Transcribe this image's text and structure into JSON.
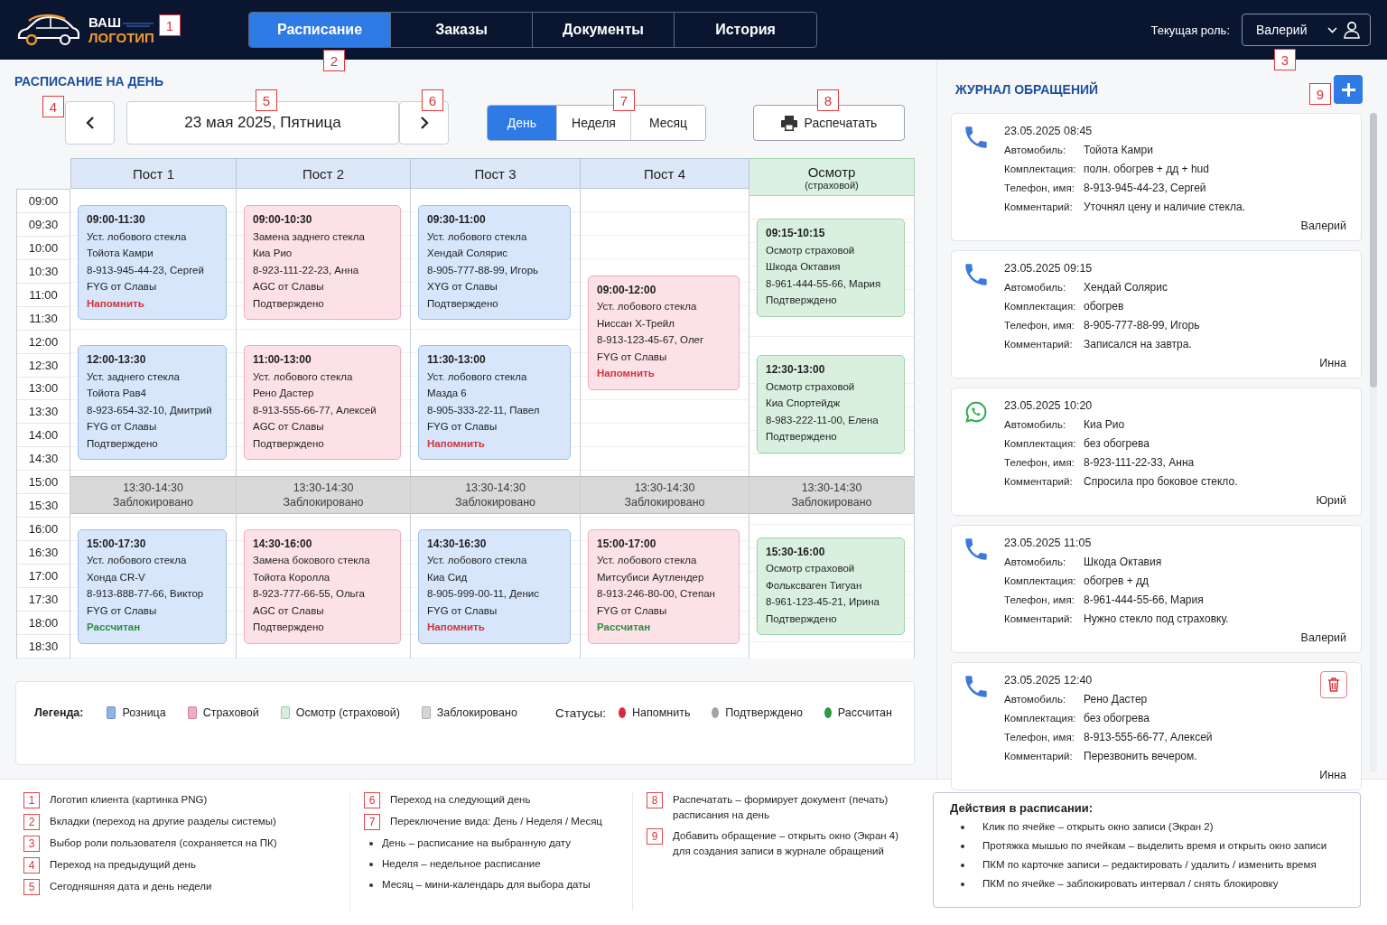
{
  "header": {
    "logo": {
      "line_1": "ВАШ",
      "line_2": "ЛОГОТИП"
    },
    "tabs": [
      {
        "label": "Расписание",
        "selected": true
      },
      {
        "label": "Заказы",
        "selected": false
      },
      {
        "label": "Документы",
        "selected": false
      },
      {
        "label": "История",
        "selected": false
      }
    ],
    "role": {
      "label": "Текущая роль:",
      "value": "Валерий"
    }
  },
  "schedule": {
    "title": "РАСПИСАНИЕ НА ДЕНЬ",
    "date": "23 мая 2025, Пятница",
    "views": [
      {
        "label": "День",
        "selected": true
      },
      {
        "label": "Неделя",
        "selected": false
      },
      {
        "label": "Месяц",
        "selected": false
      }
    ],
    "print_button": "Распечатать",
    "times": [
      "09:00",
      "09:30",
      "10:00",
      "10:30",
      "11:00",
      "11:30",
      "12:00",
      "12:30",
      "13:00",
      "13:30",
      "14:00",
      "14:30",
      "15:00",
      "15:30",
      "16:00",
      "16:30",
      "17:00",
      "17:30",
      "18:00",
      "18:30"
    ],
    "columns": [
      {
        "title": "Пост 1",
        "kind": "post",
        "upper": [
          {
            "kind": "retail",
            "time": "09:00-11:30",
            "lines": [
              "Уст. лобового стекла",
              "Тойота Камри",
              "8-913-945-44-23, Сергей",
              "FYG от Славы"
            ],
            "status": {
              "kind": "remind",
              "text": "Напомнить"
            }
          },
          {
            "kind": "retail",
            "time": "12:00-13:30",
            "lines": [
              "Уст. заднего стекла",
              "Тойота Рав4",
              "8-923-654-32-10, Дмитрий",
              "FYG от Славы"
            ],
            "status": {
              "kind": "confirmed",
              "text": "Подтверждено"
            }
          }
        ],
        "blocked": {
          "time": "13:30-14:30",
          "label": "Заблокировано"
        },
        "lower": [
          {
            "kind": "retail",
            "time": "15:00-17:30",
            "lines": [
              "Уст. лобового стекла",
              "Хонда CR-V",
              "8-913-888-77-66, Виктор",
              "FYG от Славы"
            ],
            "status": {
              "kind": "paid",
              "text": "Рассчитан"
            }
          }
        ]
      },
      {
        "title": "Пост 2",
        "kind": "post",
        "upper": [
          {
            "kind": "insurance",
            "time": "09:00-10:30",
            "lines": [
              "Замена заднего стекла",
              "Киа Рио",
              "8-923-111-22-23, Анна",
              "AGC от Славы"
            ],
            "status": {
              "kind": "confirmed",
              "text": "Подтверждено"
            }
          },
          {
            "kind": "insurance",
            "time": "11:00-13:00",
            "lines": [
              "Уст. лобового стекла",
              "Рено Дастер",
              "8-913-555-66-77, Алексей",
              "AGC от Славы"
            ],
            "status": {
              "kind": "confirmed",
              "text": "Подтверждено"
            }
          }
        ],
        "blocked": {
          "time": "13:30-14:30",
          "label": "Заблокировано"
        },
        "lower": [
          {
            "kind": "insurance",
            "time": "14:30-16:00",
            "lines": [
              "Замена бокового стекла",
              "Тойота Королла",
              "8-923-777-66-55, Ольга",
              "AGC от Славы"
            ],
            "status": {
              "kind": "confirmed",
              "text": "Подтверждено"
            }
          }
        ]
      },
      {
        "title": "Пост 3",
        "kind": "post",
        "upper": [
          {
            "kind": "retail",
            "time": "09:30-11:00",
            "lines": [
              "Уст. лобового стекла",
              "Хендай Солярис",
              "8-905-777-88-99, Игорь",
              "XYG от Славы"
            ],
            "status": {
              "kind": "confirmed",
              "text": "Подтверждено"
            }
          },
          {
            "kind": "retail",
            "time": "11:30-13:00",
            "lines": [
              "Уст. лобового стекла",
              "Мазда 6",
              "8-905-333-22-11, Павел",
              "FYG от Славы"
            ],
            "status": {
              "kind": "remind",
              "text": "Напомнить"
            }
          }
        ],
        "blocked": {
          "time": "13:30-14:30",
          "label": "Заблокировано"
        },
        "lower": [
          {
            "kind": "retail",
            "time": "14:30-16:30",
            "lines": [
              "Уст. лобового стекла",
              "Киа Сид",
              "8-905-999-00-11, Денис",
              "FYG от Славы"
            ],
            "status": {
              "kind": "remind",
              "text": "Напомнить"
            }
          }
        ]
      },
      {
        "title": "Пост 4",
        "kind": "post",
        "upper": [
          {
            "kind": "insurance",
            "time": "09:00-12:00",
            "lines": [
              "Уст. лобового стекла",
              "Ниссан X-Трейл",
              "8-913-123-45-67, Олег",
              "FYG от Славы"
            ],
            "status": {
              "kind": "remind",
              "text": "Напомнить"
            }
          }
        ],
        "blocked": {
          "time": "13:30-14:30",
          "label": "Заблокировано"
        },
        "lower": [
          {
            "kind": "insurance",
            "time": "15:00-17:00",
            "lines": [
              "Уст. лобового стекла",
              "Митсубиси Аутлендер",
              "8-913-246-80-00, Степан",
              "FYG от Славы"
            ],
            "status": {
              "kind": "paid",
              "text": "Рассчитан"
            }
          }
        ]
      },
      {
        "title": "Осмотр",
        "subtitle": "(страховой)",
        "kind": "inspection",
        "upper": [
          {
            "kind": "inspection",
            "time": "09:15-10:15",
            "lines": [
              "Осмотр страховой",
              "Шкода Октавия",
              "8-961-444-55-66, Мария"
            ],
            "status": {
              "kind": "confirmed",
              "text": "Подтверждено"
            }
          },
          {
            "kind": "inspection",
            "time": "12:30-13:00",
            "lines": [
              "Осмотр страховой",
              "Киа Спортейдж",
              "8-983-222-11-00, Елена"
            ],
            "status": {
              "kind": "confirmed",
              "text": "Подтверждено"
            }
          }
        ],
        "blocked": {
          "time": "13:30-14:30",
          "label": "Заблокировано"
        },
        "lower": [
          {
            "kind": "inspection",
            "time": "15:30-16:00",
            "lines": [
              "Осмотр страховой",
              "Фольксваген Тигуан",
              "8-961-123-45-21, Ирина"
            ],
            "status": {
              "kind": "confirmed",
              "text": "Подтверждено"
            }
          }
        ]
      }
    ],
    "legend": {
      "label": "Легенда:",
      "items": [
        {
          "label": "Розница",
          "color": "#8fb4e9"
        },
        {
          "label": "Страховой",
          "color": "#f5a9c2"
        },
        {
          "label": "Осмотр (страховой)",
          "color": "#d6efdd"
        },
        {
          "label": "Заблокировано",
          "color": "#d6d6d6"
        }
      ],
      "status_label": "Статусы:",
      "statuses": [
        {
          "label": "Напомнить",
          "color": "#d92b3a"
        },
        {
          "label": "Подтверждено",
          "color": "#a3a3a3"
        },
        {
          "label": "Рассчитан",
          "color": "#2e9a44"
        }
      ]
    }
  },
  "journal": {
    "title": "ЖУРНАЛ ОБРАЩЕНИЙ",
    "entries": [
      {
        "kind": "phone",
        "datetime": "23.05.2025  08:45",
        "fields": [
          {
            "label": "Автомобиль:",
            "value": "Тойота Камри"
          },
          {
            "label": "Комплектация:",
            "value": "полн. обогрев + дд + hud"
          },
          {
            "label": "Телефон, имя:",
            "value": "8-913-945-44-23, Сергей"
          },
          {
            "label": "Комментарий:",
            "value": "Уточнял цену и наличие стекла."
          }
        ],
        "author": "Валерий",
        "deletable": false
      },
      {
        "kind": "phone",
        "datetime": "23.05.2025  09:15",
        "fields": [
          {
            "label": "Автомобиль:",
            "value": "Хендай Солярис"
          },
          {
            "label": "Комплектация:",
            "value": "обогрев"
          },
          {
            "label": "Телефон, имя:",
            "value": "8-905-777-88-99, Игорь"
          },
          {
            "label": "Комментарий:",
            "value": "Записался на завтра."
          }
        ],
        "author": "Инна",
        "deletable": false
      },
      {
        "kind": "whatsapp",
        "datetime": "23.05.2025  10:20",
        "fields": [
          {
            "label": "Автомобиль:",
            "value": "Киа Рио"
          },
          {
            "label": "Комплектация:",
            "value": "без обогрева"
          },
          {
            "label": "Телефон, имя:",
            "value": "8-923-111-22-33, Анна"
          },
          {
            "label": "Комментарий:",
            "value": "Спросила про боковое стекло."
          }
        ],
        "author": "Юрий",
        "deletable": false
      },
      {
        "kind": "phone",
        "datetime": "23.05.2025  11:05",
        "fields": [
          {
            "label": "Автомобиль:",
            "value": "Шкода Октавия"
          },
          {
            "label": "Комплектация:",
            "value": "обогрев + дд"
          },
          {
            "label": "Телефон, имя:",
            "value": "8-961-444-55-66, Мария"
          },
          {
            "label": "Комментарий:",
            "value": "Нужно стекло под страховку."
          }
        ],
        "author": "Валерий",
        "deletable": false
      },
      {
        "kind": "phone",
        "datetime": "23.05.2025  12:40",
        "fields": [
          {
            "label": "Автомобиль:",
            "value": "Рено Дастер"
          },
          {
            "label": "Комплектация:",
            "value": "без обогрева"
          },
          {
            "label": "Телефон, имя:",
            "value": "8-913-555-66-77, Алексей"
          },
          {
            "label": "Комментарий:",
            "value": "Перезвонить вечером."
          }
        ],
        "author": "Инна",
        "deletable": true
      }
    ]
  },
  "notes": {
    "columns": [
      {
        "items": [
          {
            "number": "1",
            "text": "Логотип клиента (картинка PNG)"
          },
          {
            "number": "2",
            "text": "Вкладки (переход на другие разделы системы)"
          },
          {
            "number": "3",
            "text": "Выбор роли пользователя (сохраняется на ПК)"
          },
          {
            "number": "4",
            "text": "Переход на предыдущий день"
          },
          {
            "number": "5",
            "text": "Сегодняшняя дата и день недели"
          }
        ]
      },
      {
        "items": [
          {
            "number": "6",
            "text": "Переход на следующий день"
          },
          {
            "number": "7",
            "text": "Переключение вида: День / Неделя / Месяц"
          }
        ],
        "bullets": [
          "День – расписание на выбранную дату",
          "Неделя – недельное расписание",
          "Месяц – мини-календарь для выбора даты"
        ]
      },
      {
        "items": [
          {
            "number": "8",
            "text": "Распечатать – формирует документ (печать) расписания на день"
          },
          {
            "number": "9",
            "text": "Добавить обращение – открыть окно (Экран 4) для создания записи в журнале обращений"
          }
        ]
      }
    ],
    "actions": {
      "title": "Действия в расписании:",
      "bullets": [
        "Клик по ячейке – открыть окно записи (Экран 2)",
        "Протяжка мышью по ячейкам – выделить время и открыть окно записи",
        "ПКМ по карточке записи – редактировать / удалить / изменить время",
        "ПКМ по ячейке – заблокировать интервал / снять блокировку"
      ]
    }
  },
  "callouts": [
    "1",
    "2",
    "3",
    "4",
    "5",
    "6",
    "7",
    "8",
    "9"
  ]
}
